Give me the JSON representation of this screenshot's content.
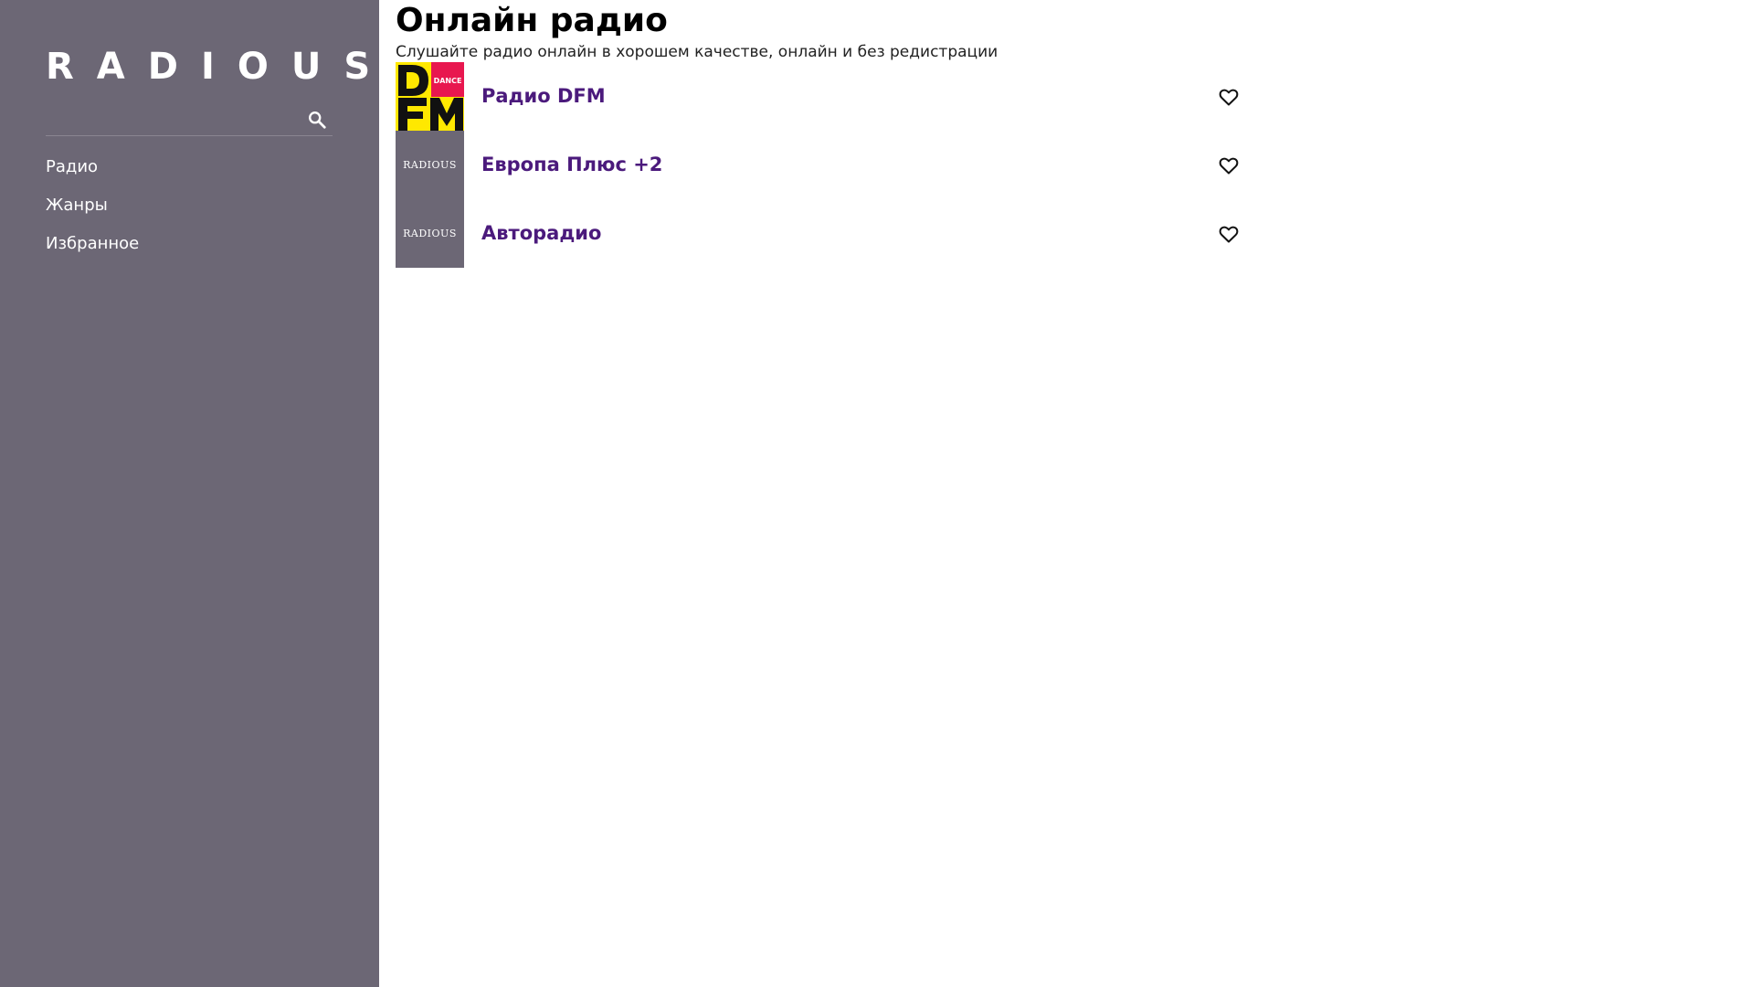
{
  "sidebar": {
    "logo": "RADIOUS",
    "search": {
      "value": "",
      "placeholder": "",
      "icon": "search-icon"
    },
    "nav": [
      {
        "label": "Радио"
      },
      {
        "label": "Жанры"
      },
      {
        "label": "Избранное"
      }
    ],
    "background_color": "#6c6775"
  },
  "main": {
    "title": "Онлайн радио",
    "subtitle": "Слушайте радио онлайн в хорошем качестве, онлайн и без редистрации",
    "stations": [
      {
        "name": "Радио DFM",
        "logo_text": "",
        "logo_badge": "DANCE",
        "fav_icon": "heart-outline-icon"
      },
      {
        "name": "Европа Плюс +2",
        "logo_text": "RADIOUS",
        "fav_icon": "heart-outline-icon"
      },
      {
        "name": "Авторадио",
        "logo_text": "RADIOUS",
        "fav_icon": "heart-outline-icon"
      }
    ],
    "accent_color": "#4b1a7c"
  }
}
